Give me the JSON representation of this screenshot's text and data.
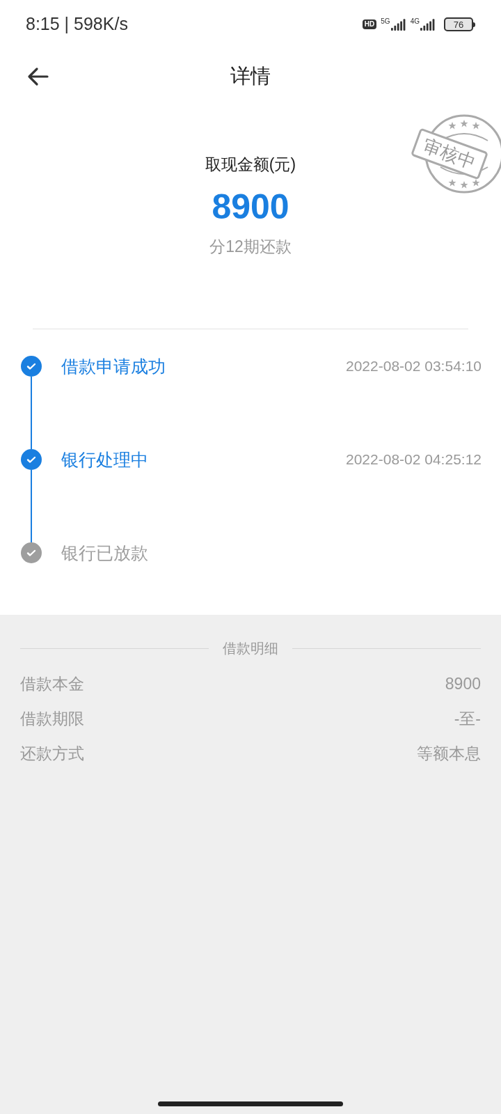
{
  "status_bar": {
    "time": "8:15 | 598K/s",
    "hd_badge": "HD",
    "network_1": "5G",
    "network_2": "4G",
    "battery": "76"
  },
  "header": {
    "title": "详情"
  },
  "summary": {
    "label": "取现金额(元)",
    "amount": "8900",
    "installments": "分12期还款",
    "stamp": "审核中"
  },
  "timeline": [
    {
      "label": "借款申请成功",
      "time": "2022-08-02 03:54:10",
      "color": "#1a7fe0"
    },
    {
      "label": "银行处理中",
      "time": "2022-08-02 04:25:12",
      "color": "#1a7fe0"
    },
    {
      "label": "银行已放款",
      "color": "#9e9e9e"
    }
  ],
  "details": {
    "title": "借款明细",
    "rows": [
      {
        "label": "借款本金",
        "value": "8900"
      },
      {
        "label": "借款期限",
        "value": "-至-"
      },
      {
        "label": "还款方式",
        "value": "等额本息"
      }
    ]
  }
}
